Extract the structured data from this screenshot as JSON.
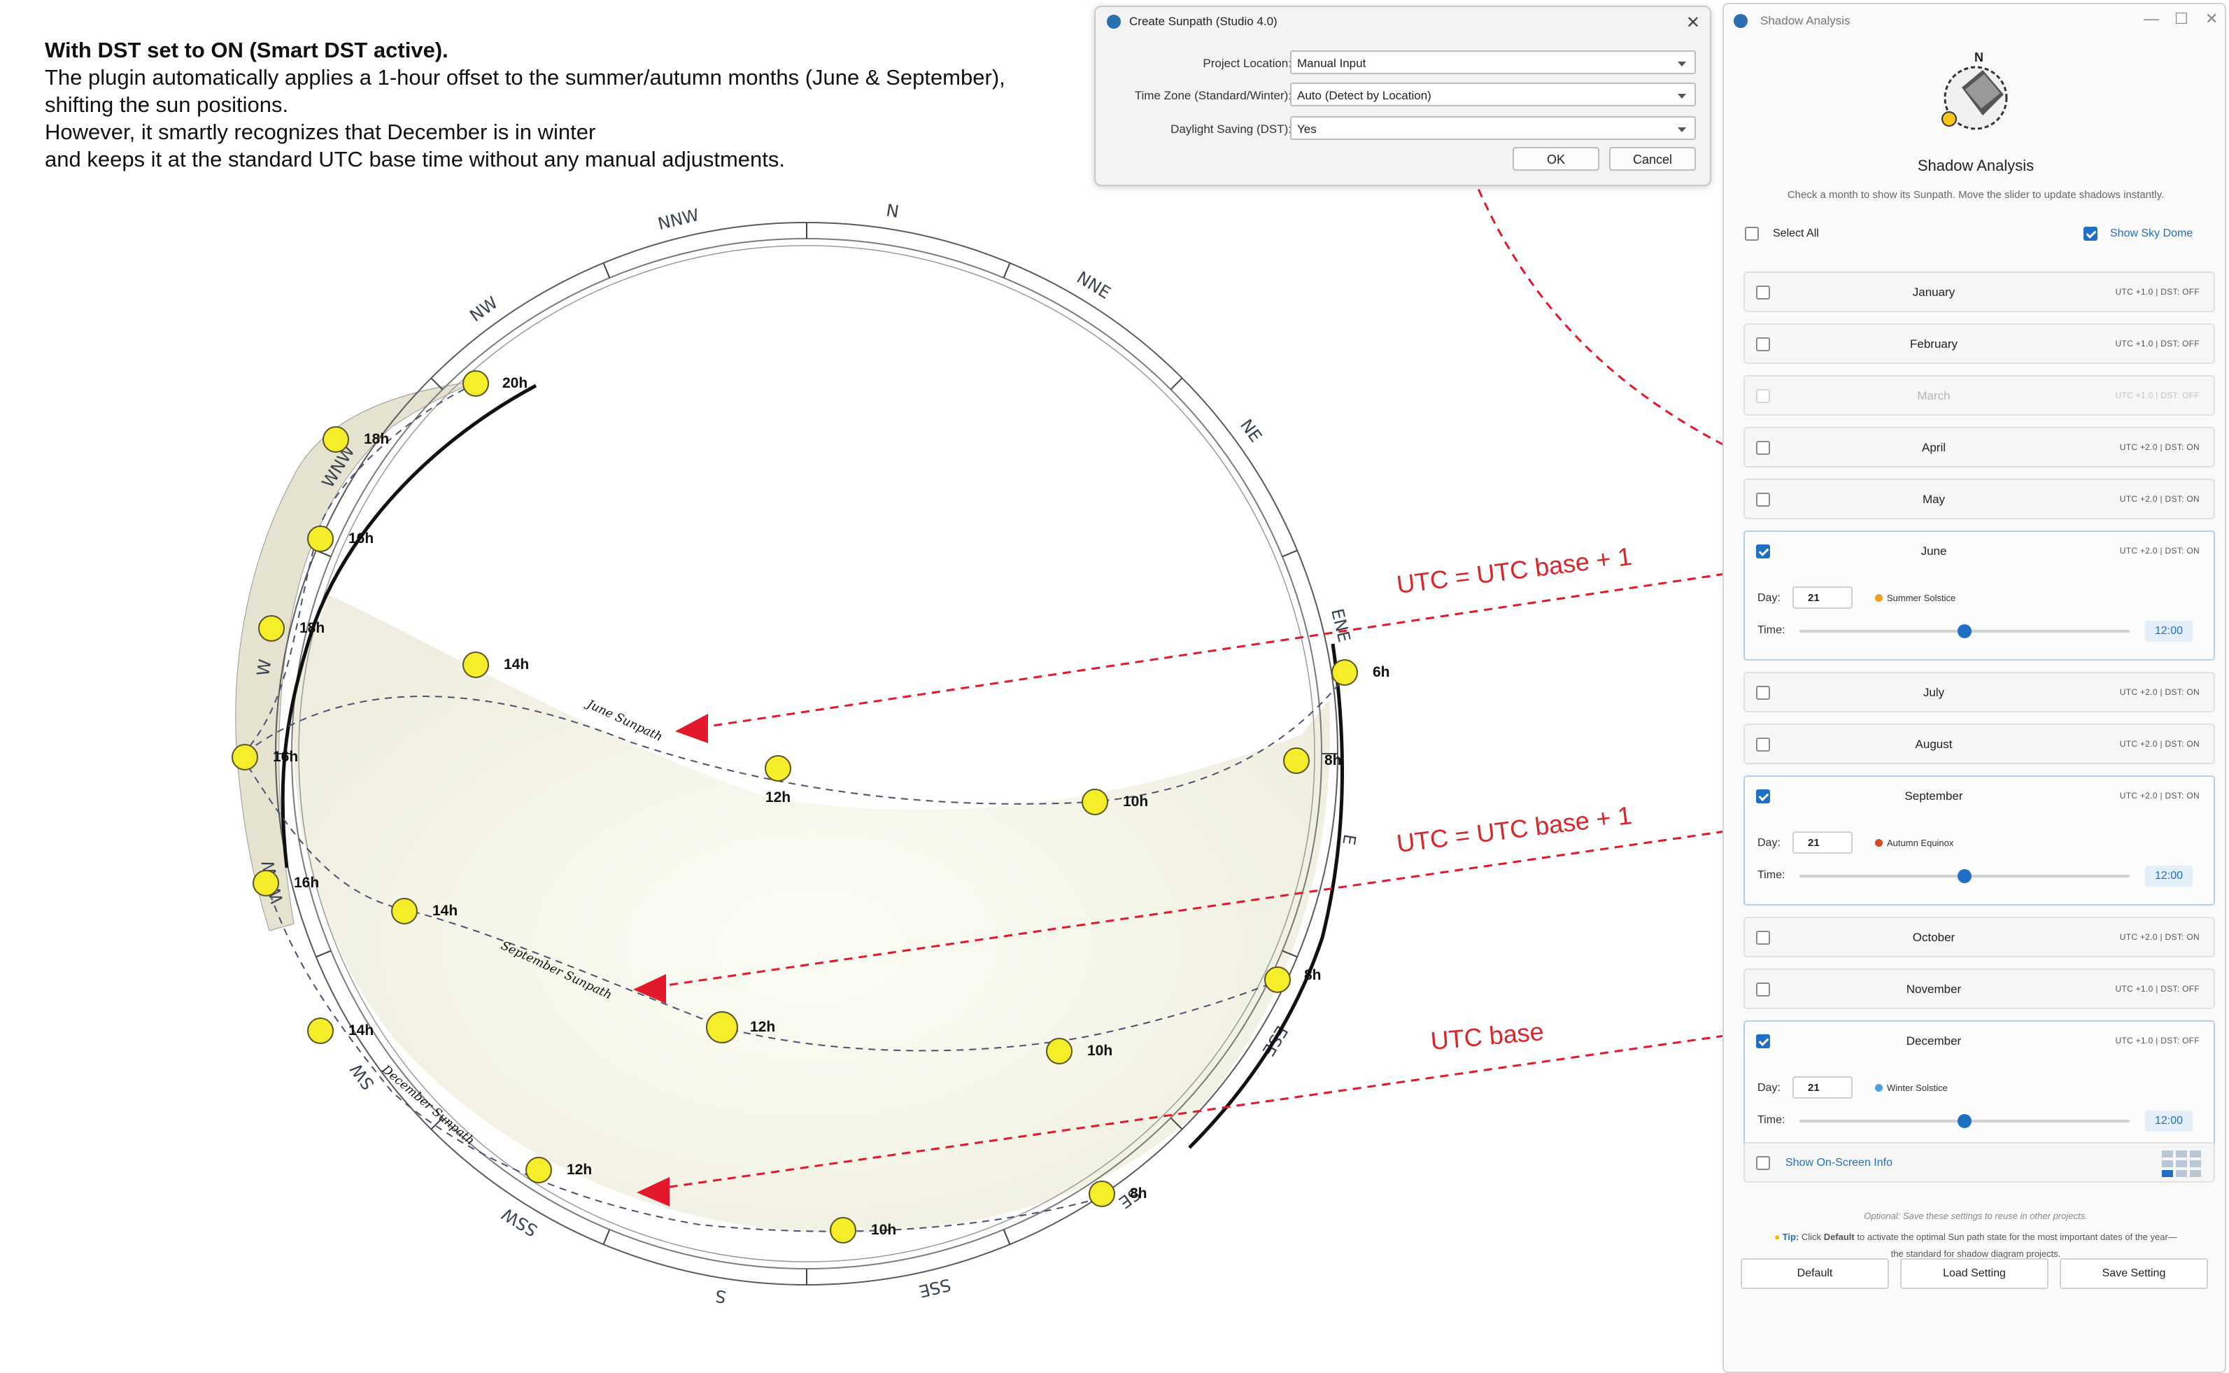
{
  "annotation": {
    "title": "With DST set to ON (Smart DST active).",
    "lines": [
      "The plugin automatically applies a 1-hour offset to the summer/autumn months (June & September),",
      "shifting the sun positions.",
      "However, it smartly recognizes that December is in winter",
      "and keeps it at the standard UTC base time without any manual adjustments."
    ]
  },
  "compass": [
    "N",
    "NNE",
    "NE",
    "ENE",
    "E",
    "ESE",
    "SE",
    "SSE",
    "S",
    "SSW",
    "SW",
    "WSW",
    "W",
    "WNW",
    "NW",
    "NNW"
  ],
  "sunpaths": {
    "june_label": "June Sunpath",
    "september_label": "September Sunpath",
    "december_label": "December Sunpath",
    "outer_hours": [
      "20h",
      "18h",
      "16h",
      "18h",
      "16h",
      "16h",
      "14h"
    ],
    "june_hours": [
      "6h",
      "8h",
      "10h",
      "12h",
      "14h"
    ],
    "september_hours": [
      "8h",
      "10h",
      "12h",
      "14h"
    ],
    "december_hours": [
      "8h",
      "10h",
      "12h"
    ]
  },
  "notes": {
    "june": "UTC = UTC base + 1",
    "september": "UTC = UTC base + 1",
    "december": "UTC base"
  },
  "dialog": {
    "title": "Create Sunpath (Studio 4.0)",
    "fields": [
      {
        "label": "Project Location:",
        "value": "Manual Input"
      },
      {
        "label": "Time Zone (Standard/Winter):",
        "value": "Auto (Detect by Location)"
      },
      {
        "label": "Daylight Saving (DST):",
        "value": "Yes"
      }
    ],
    "ok": "OK",
    "cancel": "Cancel",
    "close_glyph": "✕"
  },
  "panel": {
    "window_title": "Shadow Analysis",
    "logo_letter": "N",
    "heading": "Shadow Analysis",
    "subtitle": "Check a month to show its Sunpath. Move the slider to update shadows instantly.",
    "select_all": "Select All",
    "show_sky_dome": "Show Sky Dome",
    "day_label": "Day:",
    "time_label": "Time:",
    "months": [
      {
        "name": "January",
        "tag": "UTC +1.0 | DST: OFF",
        "checked": false
      },
      {
        "name": "February",
        "tag": "UTC +1.0 | DST: OFF",
        "checked": false
      },
      {
        "name": "March",
        "tag": "UTC +1.0 | DST: OFF",
        "checked": false,
        "disabled": true
      },
      {
        "name": "April",
        "tag": "UTC +2.0 | DST: ON",
        "checked": false
      },
      {
        "name": "May",
        "tag": "UTC +2.0 | DST: ON",
        "checked": false
      },
      {
        "name": "June",
        "tag": "UTC +2.0 | DST: ON",
        "checked": true,
        "day": "21",
        "event": "Summer Solstice",
        "time": "12:00",
        "slider": 0.5
      },
      {
        "name": "July",
        "tag": "UTC +2.0 | DST: ON",
        "checked": false
      },
      {
        "name": "August",
        "tag": "UTC +2.0 | DST: ON",
        "checked": false
      },
      {
        "name": "September",
        "tag": "UTC +2.0 | DST: ON",
        "checked": true,
        "day": "21",
        "event": "Autumn Equinox",
        "time": "12:00",
        "slider": 0.5
      },
      {
        "name": "October",
        "tag": "UTC +2.0 | DST: ON",
        "checked": false
      },
      {
        "name": "November",
        "tag": "UTC +1.0 | DST: OFF",
        "checked": false
      },
      {
        "name": "December",
        "tag": "UTC +1.0 | DST: OFF",
        "checked": true,
        "day": "21",
        "event": "Winter Solstice",
        "time": "12:00",
        "slider": 0.5
      }
    ],
    "show_onscreen_info": "Show On-Screen Info",
    "optional_note": "Optional: Save these settings to reuse in other projects.",
    "tip_label": "Tip:",
    "tip_text_a": "Click",
    "tip_default": "Default",
    "tip_text_b": "to activate the optimal Sun path state for the most important dates of the year—",
    "tip_text_c": "the standard for shadow diagram projects.",
    "buttons": {
      "default": "Default",
      "load": "Load Setting",
      "save": "Save Setting"
    }
  },
  "colors": {
    "accent": "#1f6fc4",
    "annotation_red": "#d9262b",
    "sun": "#f5ec2a"
  }
}
